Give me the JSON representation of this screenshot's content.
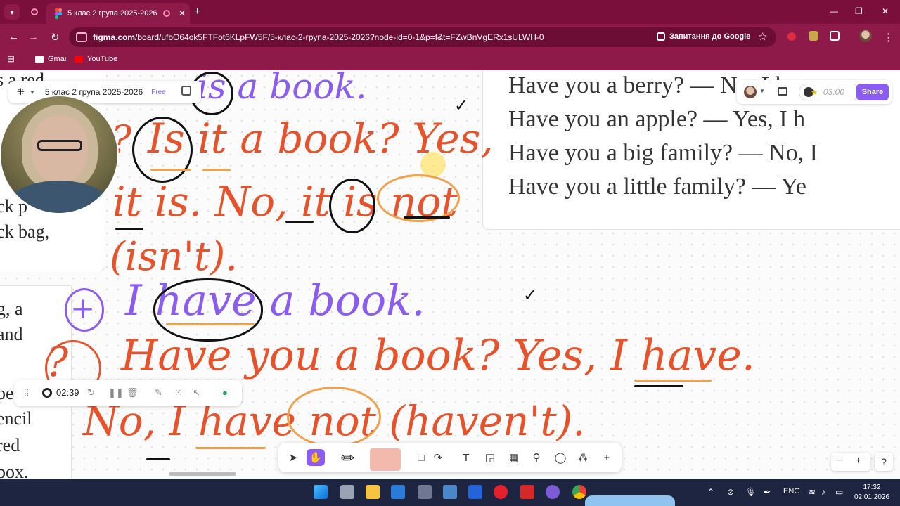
{
  "browser": {
    "tab_title": "5 клас 2 група 2025-2026 –",
    "url_host": "figma.com",
    "url_path": "/board/ufbO64ok5FTFot6KLpFW5F/5-клас-2-група-2025-2026?node-id=0-1&p=f&t=FZwBnVgERx1sULWH-0",
    "google_query": "Запитання до Google",
    "bookmarks": [
      "Gmail",
      "YouTube"
    ]
  },
  "figma": {
    "file_name": "5 клас 2 група 2025-2026",
    "plan_badge": "Free",
    "timer": "03:00",
    "share_label": "Share",
    "recording_time": "02:39"
  },
  "book_left_top": [
    "s a red",
    "",
    "",
    "",
    "ck p",
    "ck bag,"
  ],
  "book_left_bottom": [
    "g, a",
    "and",
    "",
    "pe",
    "encil",
    "red",
    "box."
  ],
  "book_right": [
    "Have you a berry? — No, I h",
    "Have you an apple? — Yes, I h",
    "Have you a big family? — No, I",
    "Have you a little family? — Ye"
  ],
  "handwriting": {
    "l1": "is a book.",
    "l2_q": "?",
    "l2": "Is it a book? Yes,",
    "l3": "it is. No, it is not",
    "l4": "(isn't).",
    "l5_plus": "+",
    "l5": "I have a book.",
    "l6_q": "?",
    "l6": "Have you a book? Yes, I have.",
    "l7": "No, I have not (haven't)."
  },
  "taskbar": {
    "lang": "ENG",
    "time": "17:32",
    "date": "02.01.2026"
  },
  "colors": {
    "browser_frame": "#8d1a48",
    "accent": "#8a5cf5",
    "pen_purple": "#8a5cf0",
    "pen_orange": "#e8522a"
  }
}
